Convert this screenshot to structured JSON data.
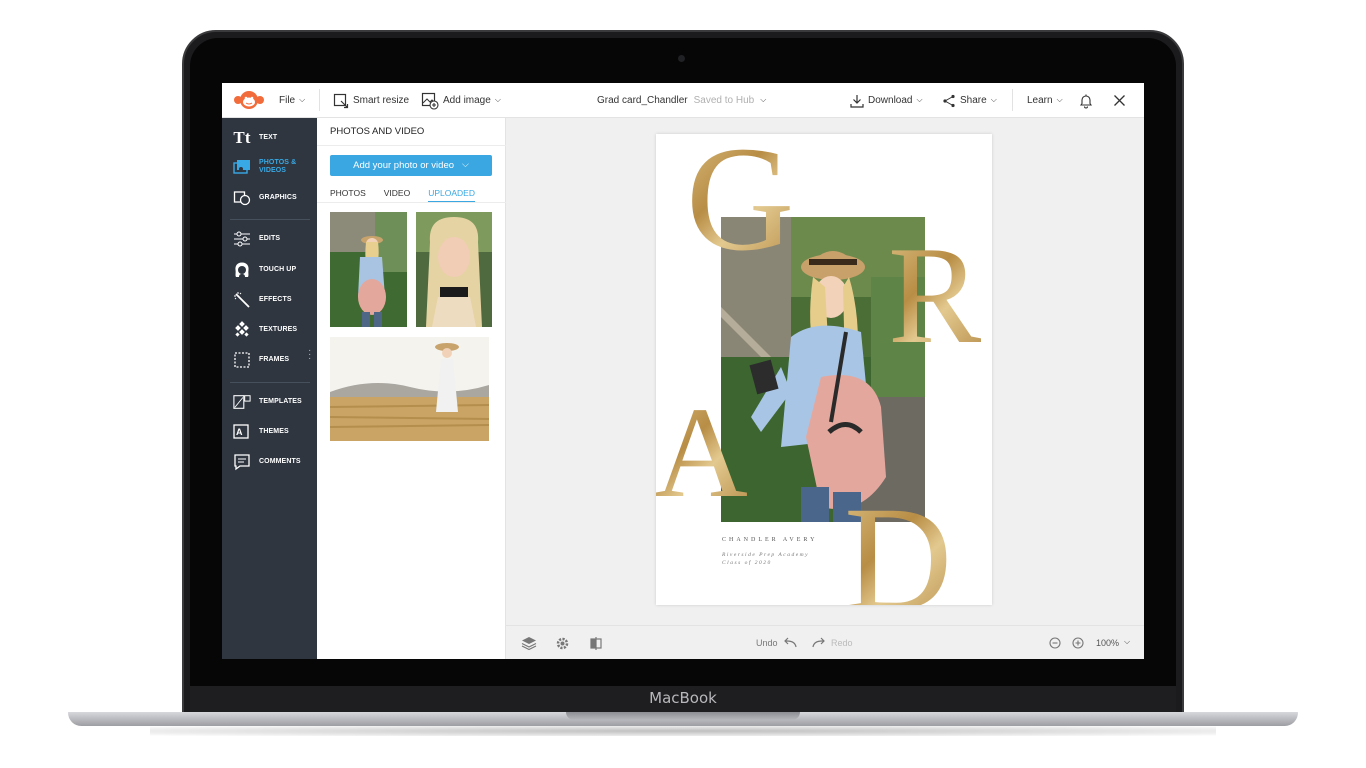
{
  "device": {
    "brand": "MacBook"
  },
  "topbar": {
    "file": "File",
    "smart_resize": "Smart resize",
    "add_image": "Add image",
    "doc_title": "Grad card_Chandler",
    "save_status": "Saved to Hub",
    "download": "Download",
    "share": "Share",
    "learn": "Learn"
  },
  "sidebar": {
    "items": [
      {
        "label": "TEXT",
        "icon": "text-icon"
      },
      {
        "label": "PHOTOS & VIDEOS",
        "icon": "photos-icon"
      },
      {
        "label": "GRAPHICS",
        "icon": "graphics-icon"
      },
      {
        "label": "EDITS",
        "icon": "sliders-icon"
      },
      {
        "label": "TOUCH UP",
        "icon": "face-icon"
      },
      {
        "label": "EFFECTS",
        "icon": "magic-wand-icon"
      },
      {
        "label": "TEXTURES",
        "icon": "texture-icon"
      },
      {
        "label": "FRAMES",
        "icon": "frame-icon"
      },
      {
        "label": "TEMPLATES",
        "icon": "templates-icon"
      },
      {
        "label": "THEMES",
        "icon": "themes-icon"
      },
      {
        "label": "COMMENTS",
        "icon": "comments-icon"
      }
    ],
    "active": "PHOTOS & VIDEOS",
    "accent": "#38a9e5"
  },
  "panel": {
    "title": "PHOTOS AND VIDEO",
    "add_button": "Add your photo or video",
    "tabs": [
      "PHOTOS",
      "VIDEO",
      "UPLOADED"
    ],
    "active_tab": "UPLOADED"
  },
  "card": {
    "letters": [
      "G",
      "R",
      "A",
      "D"
    ],
    "name": "CHANDLER AVERY",
    "school_line1": "Riverside Prep Academy",
    "school_line2": "Class of 2020",
    "gold_color": "#c8a35a"
  },
  "bottombar": {
    "undo": "Undo",
    "redo": "Redo",
    "zoom": "100%"
  }
}
